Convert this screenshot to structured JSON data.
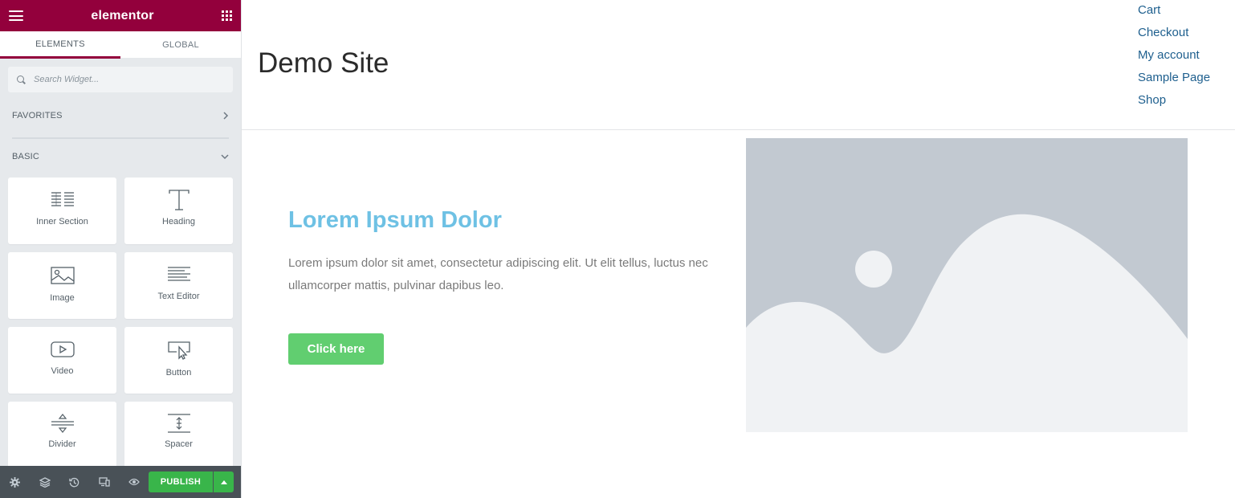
{
  "panel": {
    "brand": "elementor",
    "tabs": [
      {
        "label": "ELEMENTS",
        "active": true
      },
      {
        "label": "GLOBAL",
        "active": false
      }
    ],
    "search_placeholder": "Search Widget...",
    "categories": [
      {
        "label": "FAVORITES",
        "expanded": false
      },
      {
        "label": "BASIC",
        "expanded": true
      }
    ],
    "widgets": [
      {
        "label": "Inner Section",
        "icon": "inner-section-icon"
      },
      {
        "label": "Heading",
        "icon": "heading-icon"
      },
      {
        "label": "Image",
        "icon": "image-icon"
      },
      {
        "label": "Text Editor",
        "icon": "text-editor-icon"
      },
      {
        "label": "Video",
        "icon": "video-icon"
      },
      {
        "label": "Button",
        "icon": "button-icon"
      },
      {
        "label": "Divider",
        "icon": "divider-icon"
      },
      {
        "label": "Spacer",
        "icon": "spacer-icon"
      }
    ],
    "footer": {
      "publish_label": "PUBLISH",
      "icons": [
        "settings-icon",
        "navigator-icon",
        "history-icon",
        "responsive-icon",
        "preview-icon"
      ]
    }
  },
  "site": {
    "title": "Demo Site",
    "nav": [
      "Cart",
      "Checkout",
      "My account",
      "Sample Page",
      "Shop"
    ],
    "hero": {
      "heading": "Lorem Ipsum Dolor",
      "text": "Lorem ipsum dolor sit amet, consectetur adipiscing elit. Ut elit tellus, luctus nec ullamcorper mattis, pulvinar dapibus leo.",
      "button": "Click here"
    }
  },
  "colors": {
    "brand": "#93003c",
    "publish": "#39b54a",
    "hero_heading": "#6ec1e4",
    "hero_button": "#61ce70",
    "nav_link": "#1e5f8e"
  }
}
